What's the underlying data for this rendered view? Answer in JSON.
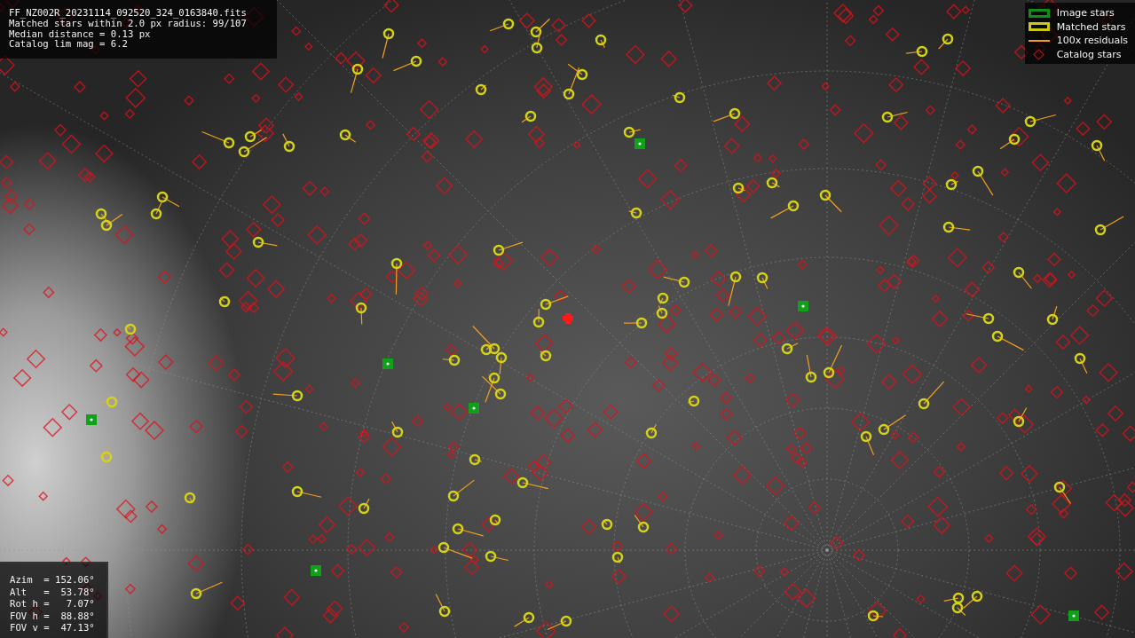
{
  "info_lines": [
    "FF_NZ002R_20231114_092520_324_0163840.fits",
    "Matched stars within 2.0 px radius: 99/107",
    "Median distance = 0.13 px",
    "Catalog lim mag = 6.2"
  ],
  "legend": [
    {
      "kind": "image",
      "label": "Image stars"
    },
    {
      "kind": "matched",
      "label": "Matched stars"
    },
    {
      "kind": "residual",
      "label": "100x residuals"
    },
    {
      "kind": "catalog",
      "label": "Catalog stars"
    }
  ],
  "pointing_lines": [
    "Azim  = 152.06°",
    "Alt   =  53.78°",
    "Rot h =   7.07°",
    "FOV h =  88.88°",
    "FOV v =  47.13°"
  ]
}
